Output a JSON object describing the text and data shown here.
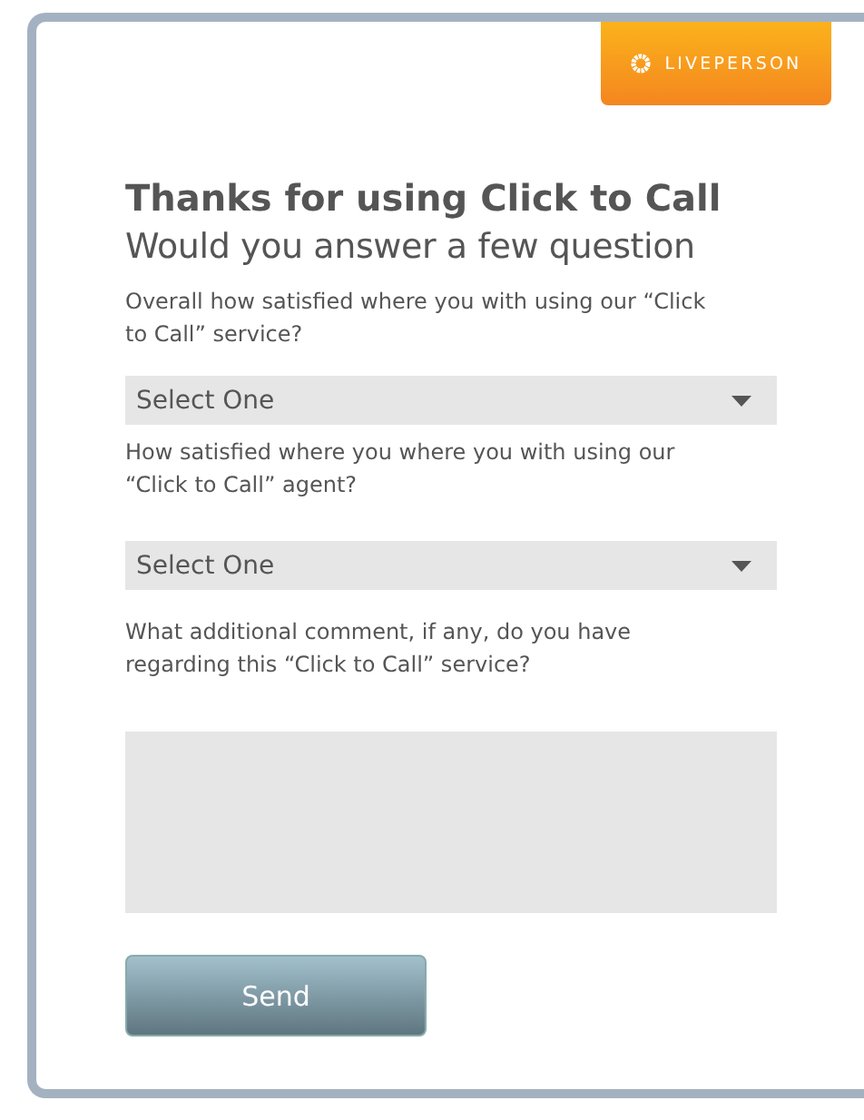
{
  "logo": {
    "text": "LIVEPERSON"
  },
  "title": "Thanks for using Click to Call",
  "subtitle": "Would you answer a few question",
  "questions": [
    {
      "kind": "select",
      "label": "Overall how satisfied where you with using our “Click to Call” service?",
      "value": "Select One"
    },
    {
      "kind": "select",
      "label": "How satisfied where you where you with using our “Click to Call” agent?",
      "value": "Select One"
    },
    {
      "kind": "textarea",
      "label": "What additional comment, if any, do you have regarding this “Click to Call” service?"
    }
  ],
  "submit": {
    "label": "Send"
  }
}
